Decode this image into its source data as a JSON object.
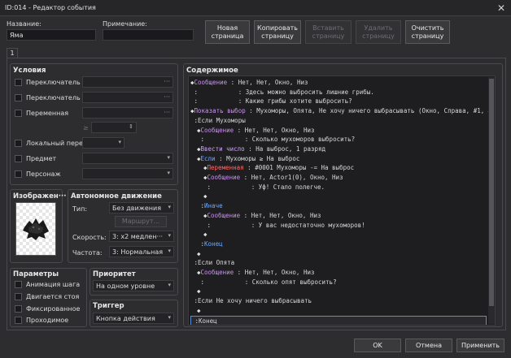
{
  "window": {
    "title": "ID:014 - Редактор события",
    "close_glyph": "✕"
  },
  "header": {
    "name_label": "Название:",
    "name_value": "Яма",
    "note_label": "Примечание:",
    "note_value": "",
    "buttons": {
      "new_page": [
        "Новая",
        "страница"
      ],
      "copy_page": [
        "Копировать",
        "страницу"
      ],
      "paste_page": [
        "Вставить",
        "страницу"
      ],
      "delete_page": [
        "Удалить",
        "страницу"
      ],
      "clear_page": [
        "Очистить",
        "страницу"
      ]
    }
  },
  "tabs": [
    "1"
  ],
  "conditions": {
    "title": "Условия",
    "switch1": "Переключатель",
    "switch2": "Переключатель",
    "variable": "Переменная",
    "self_switch": "Локальный перек···",
    "item": "Предмет",
    "actor": "Персонаж",
    "ellipsis": "···",
    "dropdown_glyph": "▾",
    "spin_glyph": "⇕"
  },
  "image": {
    "title": "Изображен···",
    "icon": "black-spiky-pit-sprite"
  },
  "autonomous": {
    "title": "Автономное движение",
    "type_label": "Тип:",
    "type_value": "Без движения",
    "route_button": "Маршрут...",
    "speed_label": "Скорость:",
    "speed_value": "3: x2 медлен···",
    "freq_label": "Частота:",
    "freq_value": "3: Нормальная"
  },
  "options": {
    "title": "Параметры",
    "items": [
      "Анимация шага",
      "Двигается стоя",
      "Фиксированное",
      "Проходимое"
    ]
  },
  "priority": {
    "title": "Приоритет",
    "value": "На одном уровне"
  },
  "trigger": {
    "title": "Триггер",
    "value": "Кнопка действия"
  },
  "contents": {
    "title": "Содержимое",
    "lines": [
      {
        "indent": 0,
        "mark": "◆",
        "cmd": "Сообщение",
        "arg": "Нет, Нет, Окно, Низ",
        "kind": "msg"
      },
      {
        "indent": 0,
        "mark": " :",
        "cmd": "",
        "arg": "           : Здесь можно выбросить лишние грибы.",
        "kind": "msg"
      },
      {
        "indent": 0,
        "mark": " :",
        "cmd": "",
        "arg": "           : Какие грибы хотите выбросить?",
        "kind": "msg"
      },
      {
        "indent": 0,
        "mark": "◆",
        "cmd": "Показать выбор",
        "arg": "Мухоморы, Опята, Не хочу ничего выбрасывать (Окно, Справа, #1, #3)",
        "kind": "msg"
      },
      {
        "indent": 0,
        "mark": " :",
        "cmd": "Если Мухоморы",
        "arg": "",
        "kind": "when"
      },
      {
        "indent": 1,
        "mark": "◆",
        "cmd": "Сообщение",
        "arg": "Нет, Нет, Окно, Низ",
        "kind": "msg"
      },
      {
        "indent": 1,
        "mark": " :",
        "cmd": "",
        "arg": "           : Сколько мухоморов выбросить?",
        "kind": "msg"
      },
      {
        "indent": 1,
        "mark": "◆",
        "cmd": "Ввести число",
        "arg": "На выброс, 1 разряд",
        "kind": "num"
      },
      {
        "indent": 1,
        "mark": "◆",
        "cmd": "Если",
        "arg": "Мухоморы ≥ На выброс",
        "kind": "if"
      },
      {
        "indent": 2,
        "mark": "◆",
        "cmd": "Переменная",
        "arg": "#0001 Мухоморы -= На выброс",
        "kind": "var"
      },
      {
        "indent": 2,
        "mark": "◆",
        "cmd": "Сообщение",
        "arg": "Нет, Actor1(0), Окно, Низ",
        "kind": "msg"
      },
      {
        "indent": 2,
        "mark": " :",
        "cmd": "",
        "arg": "           : Уф! Стало полегче.",
        "kind": "msg"
      },
      {
        "indent": 2,
        "mark": "◆",
        "cmd": "",
        "arg": "",
        "kind": "msg"
      },
      {
        "indent": 1,
        "mark": " :",
        "cmd": "Иначе",
        "arg": "",
        "kind": "if"
      },
      {
        "indent": 2,
        "mark": "◆",
        "cmd": "Сообщение",
        "arg": "Нет, Нет, Окно, Низ",
        "kind": "msg"
      },
      {
        "indent": 2,
        "mark": " :",
        "cmd": "",
        "arg": "           : У вас недостаточно мухоморов!",
        "kind": "msg"
      },
      {
        "indent": 2,
        "mark": "◆",
        "cmd": "",
        "arg": "",
        "kind": "msg"
      },
      {
        "indent": 1,
        "mark": " :",
        "cmd": "Конец",
        "arg": "",
        "kind": "if"
      },
      {
        "indent": 1,
        "mark": "◆",
        "cmd": "",
        "arg": "",
        "kind": "msg"
      },
      {
        "indent": 0,
        "mark": " :",
        "cmd": "Если Опята",
        "arg": "",
        "kind": "when"
      },
      {
        "indent": 1,
        "mark": "◆",
        "cmd": "Сообщение",
        "arg": "Нет, Нет, Окно, Низ",
        "kind": "msg"
      },
      {
        "indent": 1,
        "mark": " :",
        "cmd": "",
        "arg": "           : Сколько опят выбросить?",
        "kind": "msg"
      },
      {
        "indent": 1,
        "mark": "◆",
        "cmd": "",
        "arg": "",
        "kind": "msg"
      },
      {
        "indent": 0,
        "mark": " :",
        "cmd": "Если Не хочу ничего выбрасывать",
        "arg": "",
        "kind": "when"
      },
      {
        "indent": 1,
        "mark": "◆",
        "cmd": "",
        "arg": "",
        "kind": "msg"
      },
      {
        "indent": 0,
        "mark": " :",
        "cmd": "Конец",
        "arg": "",
        "kind": "when"
      }
    ],
    "colors": {
      "msg": "#c792ea",
      "num": "#d0a0ff",
      "if": "#6fa8ff",
      "var": "#ff6b6b",
      "when": "#d8d8d8"
    }
  },
  "footer": {
    "ok": "OK",
    "cancel": "Отмена",
    "apply": "Применить"
  }
}
